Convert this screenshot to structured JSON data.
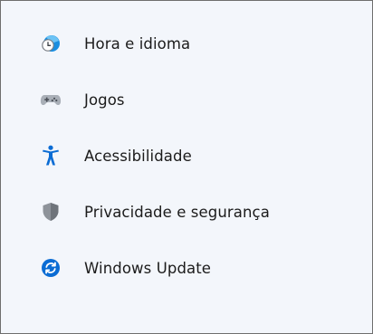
{
  "sidebar": {
    "items": [
      {
        "label": "Hora e idioma",
        "icon": "clock-globe-icon"
      },
      {
        "label": "Jogos",
        "icon": "gamepad-icon"
      },
      {
        "label": "Acessibilidade",
        "icon": "accessibility-person-icon"
      },
      {
        "label": "Privacidade e segurança",
        "icon": "shield-icon"
      },
      {
        "label": "Windows Update",
        "icon": "sync-arrows-icon"
      }
    ]
  },
  "colors": {
    "background": "#f3f6fb",
    "text": "#1b1b1b",
    "accent_blue": "#0a6cd4",
    "shield_gray": "#8e939a"
  }
}
